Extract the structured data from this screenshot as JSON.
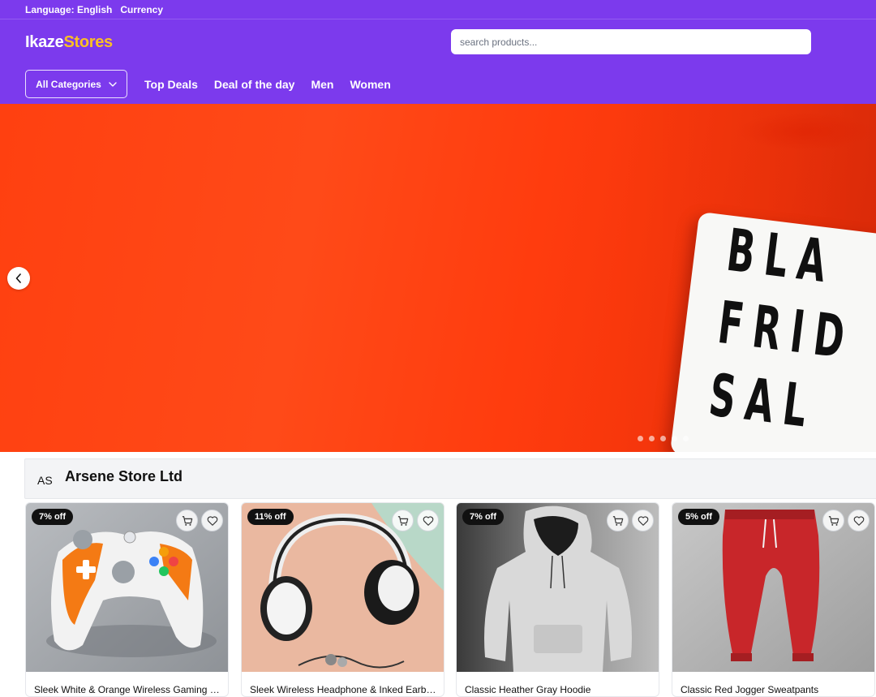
{
  "topbar": {
    "language_label": "Language: English",
    "currency_label": "Currency"
  },
  "header": {
    "logo_part1": "Ikaze",
    "logo_part2": "Stores",
    "search_placeholder": "search products..."
  },
  "nav": {
    "categories_label": "All Categories",
    "links": [
      "Top Deals",
      "Deal of the day",
      "Men",
      "Women"
    ]
  },
  "hero": {
    "sign_lines": [
      "BLA",
      "FRID",
      "SAL"
    ],
    "slide_count": 5,
    "prev_icon": "chevron-left-icon"
  },
  "store": {
    "abbr": "AS",
    "name": "Arsene Store Ltd"
  },
  "products": [
    {
      "discount": "7% off",
      "title": "Sleek White & Orange Wireless Gaming Controller"
    },
    {
      "discount": "11% off",
      "title": "Sleek Wireless Headphone & Inked Earbuds"
    },
    {
      "discount": "7% off",
      "title": "Classic Heather Gray Hoodie"
    },
    {
      "discount": "5% off",
      "title": "Classic Red Jogger Sweatpants"
    }
  ],
  "icons": {
    "cart": "cart-icon",
    "heart": "heart-icon",
    "chevron_down": "chevron-down-icon"
  },
  "colors": {
    "brand": "#7c3aed",
    "accent": "#fbbf24",
    "hero": "#ff4412"
  }
}
